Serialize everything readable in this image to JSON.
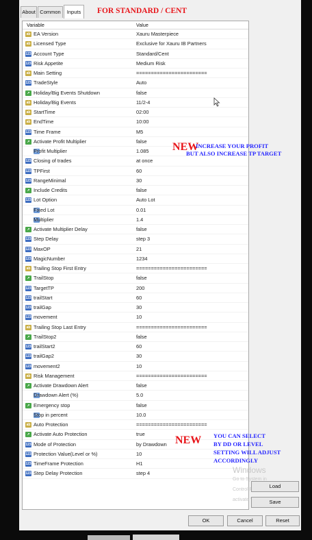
{
  "tabs": [
    "About",
    "Common",
    "Inputs"
  ],
  "title_banner": "FOR STANDARD / CENT",
  "columns": {
    "variable": "Variable",
    "value": "Value"
  },
  "rows": [
    {
      "icon": "ab",
      "name": "EA Version",
      "value": "Xauru Masterpiece"
    },
    {
      "icon": "ab",
      "name": "Licensed Type",
      "value": "Exclusive for Xauru IB Partners"
    },
    {
      "icon": "bl",
      "name": "Account Type",
      "value": "Standard/Cent"
    },
    {
      "icon": "bl",
      "name": "Risk Appetite",
      "value": "Medium Risk"
    },
    {
      "icon": "ab",
      "name": "Main Setting",
      "value": "========================"
    },
    {
      "icon": "bl",
      "name": "TradeStyle",
      "value": "Auto"
    },
    {
      "icon": "gr",
      "name": "Holiday/Big Events Shutdown",
      "value": "false"
    },
    {
      "icon": "ab",
      "name": "Holiday/Big Events",
      "value": "11/2-4"
    },
    {
      "icon": "ab",
      "name": "StartTime",
      "value": "02:00"
    },
    {
      "icon": "ab",
      "name": "EndTime",
      "value": "10:00"
    },
    {
      "icon": "bl",
      "name": "Time Frame",
      "value": "M5"
    },
    {
      "icon": "gr",
      "name": "Activate Profit Multiplier",
      "value": "false"
    },
    {
      "icon": "nm",
      "name": "Profit Multiplier",
      "value": "1.085"
    },
    {
      "icon": "bl",
      "name": "Closing of trades",
      "value": "at once"
    },
    {
      "icon": "bl",
      "name": "TPFirst",
      "value": "60"
    },
    {
      "icon": "bl",
      "name": "RangeMinimal",
      "value": "30"
    },
    {
      "icon": "gr",
      "name": "Include Credits",
      "value": "false"
    },
    {
      "icon": "bl",
      "name": "Lot Option",
      "value": "Auto Lot"
    },
    {
      "icon": "nm",
      "name": "Fixed Lot",
      "value": "0.01"
    },
    {
      "icon": "nm",
      "name": "Multiplier",
      "value": "1.4"
    },
    {
      "icon": "gr",
      "name": "Activate Multiplier Delay",
      "value": "false"
    },
    {
      "icon": "bl",
      "name": "Step Delay",
      "value": "step 3"
    },
    {
      "icon": "bl",
      "name": "MaxOP",
      "value": "21"
    },
    {
      "icon": "bl",
      "name": "MagicNumber",
      "value": "1234"
    },
    {
      "icon": "ab",
      "name": "Trailing Stop First Entry",
      "value": "========================"
    },
    {
      "icon": "gr",
      "name": "TrailStop",
      "value": "false"
    },
    {
      "icon": "bl",
      "name": "TargetTP",
      "value": "200"
    },
    {
      "icon": "bl",
      "name": "trailStart",
      "value": "60"
    },
    {
      "icon": "bl",
      "name": "trailGap",
      "value": "30"
    },
    {
      "icon": "bl",
      "name": "movement",
      "value": "10"
    },
    {
      "icon": "ab",
      "name": "Trailing Stop Last Entry",
      "value": "========================"
    },
    {
      "icon": "gr",
      "name": "TrailStop2",
      "value": "false"
    },
    {
      "icon": "bl",
      "name": "trailStart2",
      "value": "60"
    },
    {
      "icon": "bl",
      "name": "trailGap2",
      "value": "30"
    },
    {
      "icon": "bl",
      "name": "movement2",
      "value": "10"
    },
    {
      "icon": "ab",
      "name": "Risk Management",
      "value": "========================"
    },
    {
      "icon": "gr",
      "name": "Activate Drawdown Alert",
      "value": "false"
    },
    {
      "icon": "nm",
      "name": "Drawdown Alert (%)",
      "value": "5.0"
    },
    {
      "icon": "gr",
      "name": "Emergency stop",
      "value": "false"
    },
    {
      "icon": "nm",
      "name": "Stop in percent",
      "value": "10.0"
    },
    {
      "icon": "ab",
      "name": "Auto Protection",
      "value": "========================"
    },
    {
      "icon": "gr",
      "name": "Activate Auto Protection",
      "value": "true"
    },
    {
      "icon": "bl",
      "name": "Mode of Protection",
      "value": "by Drawdown"
    },
    {
      "icon": "bl",
      "name": "Protection Value(Level or %)",
      "value": "10"
    },
    {
      "icon": "bl",
      "name": "TimeFrame Protection",
      "value": "H1"
    },
    {
      "icon": "bl",
      "name": "Step Delay Protection",
      "value": "step 4"
    }
  ],
  "annotation1": {
    "new": "NEW",
    "line1": "INCREASE YOUR PROFIT",
    "line2": "BUT ALSO INCREASE TP TARGET"
  },
  "annotation2": {
    "new": "NEW",
    "line1": "YOU CAN SELECT",
    "line2": "BY DD OR LEVEL",
    "line3": "SETTING WILL ADJUST",
    "line4": "ACCORDINGLY"
  },
  "watermark": {
    "line1": "Windows",
    "line2": "Go to System in",
    "line3": "Control Panel to",
    "line4": "activate Windows."
  },
  "buttons": {
    "load": "Load",
    "save": "Save",
    "ok": "OK",
    "cancel": "Cancel",
    "reset": "Reset"
  },
  "colors": {
    "banner_red": "#e8151a",
    "annotation_blue": "#2626ff"
  }
}
